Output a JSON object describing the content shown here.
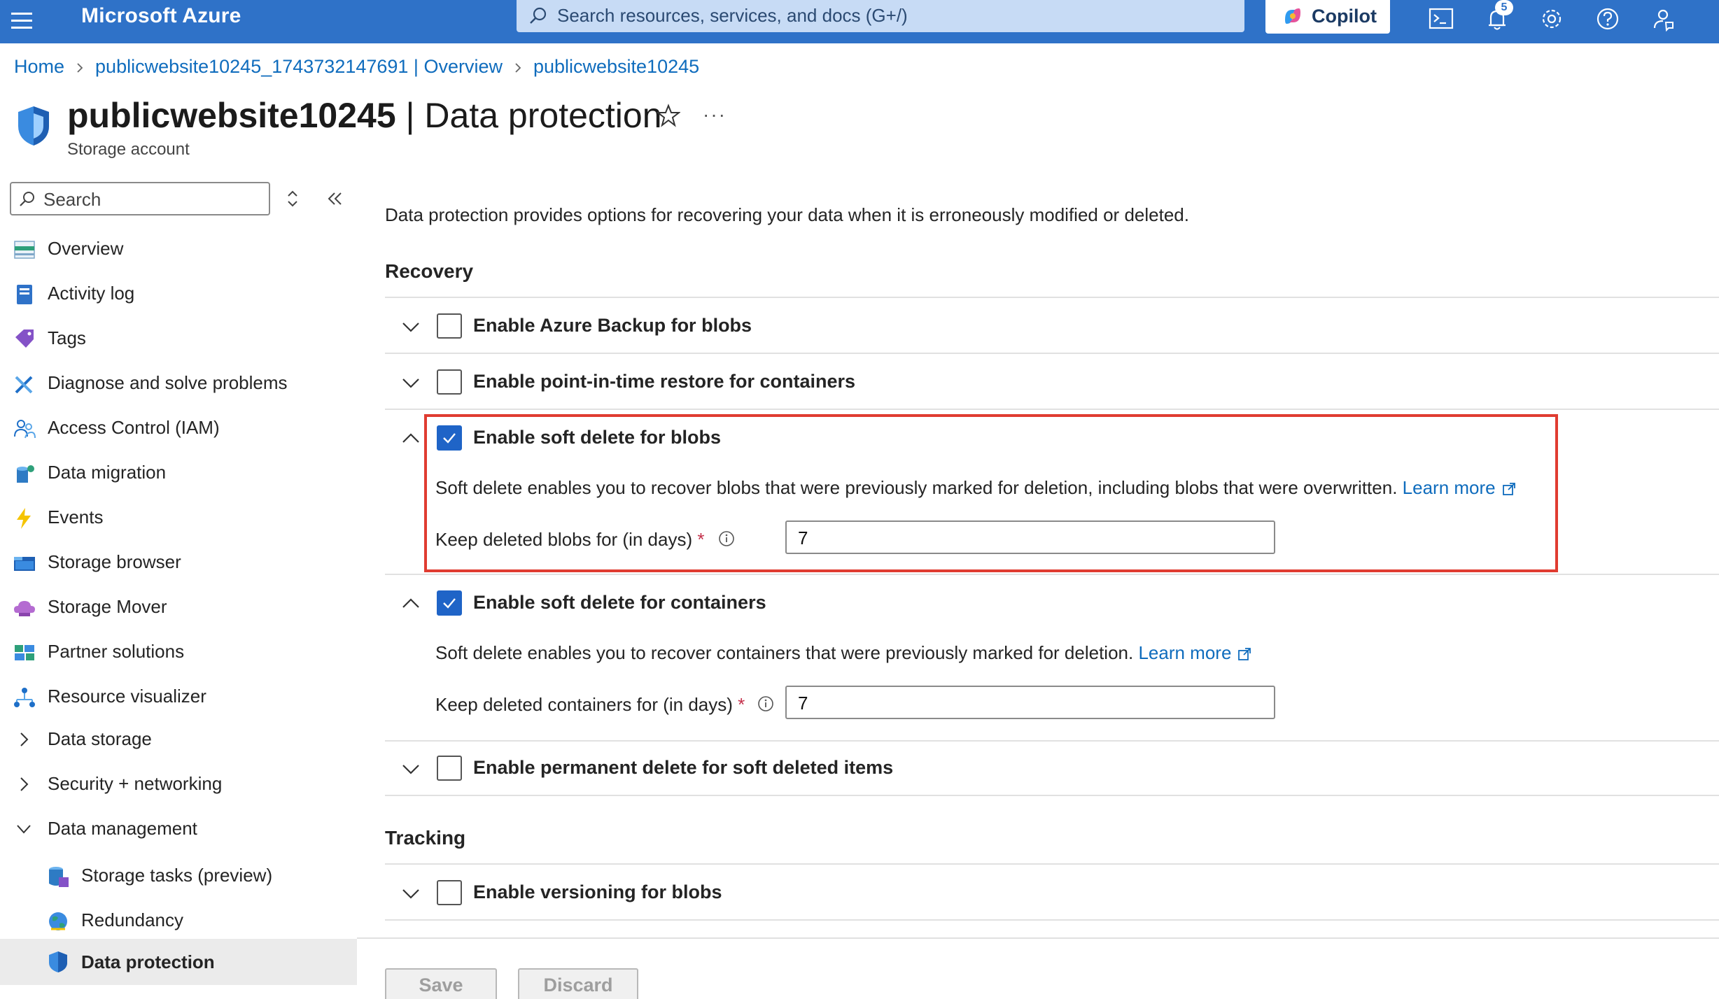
{
  "topbar": {
    "brand": "Microsoft Azure",
    "search_placeholder": "Search resources, services, and docs (G+/)",
    "copilot_label": "Copilot",
    "notification_count": "5",
    "icons": [
      "cloud-shell-icon",
      "notifications-icon",
      "settings-icon",
      "help-icon",
      "feedback-icon"
    ]
  },
  "breadcrumb": {
    "items": [
      "Home",
      "publicwebsite10245_1743732147691 | Overview",
      "publicwebsite10245"
    ]
  },
  "header": {
    "title_bold": "publicwebsite10245",
    "title_rest": " | Data protection",
    "subtitle": "Storage account",
    "more": "···"
  },
  "sidebar": {
    "search_placeholder": "Search",
    "items": [
      {
        "label": "Overview",
        "icon": "overview-icon"
      },
      {
        "label": "Activity log",
        "icon": "activity-log-icon"
      },
      {
        "label": "Tags",
        "icon": "tag-icon"
      },
      {
        "label": "Diagnose and solve problems",
        "icon": "wrench-icon"
      },
      {
        "label": "Access Control (IAM)",
        "icon": "people-icon"
      },
      {
        "label": "Data migration",
        "icon": "data-migration-icon"
      },
      {
        "label": "Events",
        "icon": "lightning-icon"
      },
      {
        "label": "Storage browser",
        "icon": "storage-browser-icon"
      },
      {
        "label": "Storage Mover",
        "icon": "cloud-icon"
      },
      {
        "label": "Partner solutions",
        "icon": "partner-icon"
      },
      {
        "label": "Resource visualizer",
        "icon": "visualizer-icon"
      }
    ],
    "groups": [
      {
        "label": "Data storage",
        "expanded": false
      },
      {
        "label": "Security + networking",
        "expanded": false
      },
      {
        "label": "Data management",
        "expanded": true
      }
    ],
    "sub_items": [
      {
        "label": "Storage tasks (preview)",
        "icon": "storage-tasks-icon"
      },
      {
        "label": "Redundancy",
        "icon": "globe-icon"
      },
      {
        "label": "Data protection",
        "icon": "shield-icon",
        "active": true
      }
    ]
  },
  "main": {
    "intro": "Data protection provides options for recovering your data when it is erroneously modified or deleted.",
    "recovery_title": "Recovery",
    "tracking_title": "Tracking",
    "options": {
      "azure_backup": {
        "label": "Enable Azure Backup for blobs",
        "checked": false
      },
      "pitr": {
        "label": "Enable point-in-time restore for containers",
        "checked": false
      },
      "soft_delete_blobs": {
        "label": "Enable soft delete for blobs",
        "checked": true,
        "desc": "Soft delete enables you to recover blobs that were previously marked for deletion, including blobs that were overwritten.",
        "link": "Learn more",
        "field_label": "Keep deleted blobs for (in days)",
        "required": "*",
        "value": "7"
      },
      "soft_delete_containers": {
        "label": "Enable soft delete for containers",
        "checked": true,
        "desc": "Soft delete enables you to recover containers that were previously marked for deletion.",
        "link": "Learn more",
        "field_label": "Keep deleted containers for (in days)",
        "required": "*",
        "value": "7"
      },
      "permanent_delete": {
        "label": "Enable permanent delete for soft deleted items",
        "checked": false
      },
      "versioning": {
        "label": "Enable versioning for blobs",
        "checked": false
      }
    }
  },
  "footer": {
    "save_label": "Save",
    "discard_label": "Discard"
  },
  "colors": {
    "topbar": "#2f72c8",
    "link": "#0f6cbd",
    "checkbox_checked": "#1f64c7",
    "highlight": "#e03c31"
  }
}
